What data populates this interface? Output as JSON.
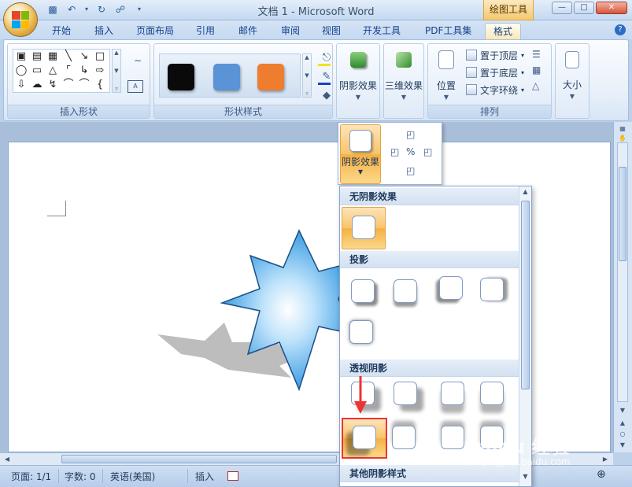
{
  "window": {
    "title": "文档 1 - Microsoft Word",
    "context_tab_label": "绘图工具"
  },
  "tabs": [
    {
      "label": "开始"
    },
    {
      "label": "插入"
    },
    {
      "label": "页面布局"
    },
    {
      "label": "引用"
    },
    {
      "label": "邮件"
    },
    {
      "label": "审阅"
    },
    {
      "label": "视图"
    },
    {
      "label": "开发工具"
    },
    {
      "label": "PDF工具集"
    },
    {
      "label": "格式",
      "active": true
    }
  ],
  "ribbon": {
    "groups": {
      "insert_shapes": "插入形状",
      "shape_styles": "形状样式",
      "arrange": "排列"
    },
    "shape_style_swatches": [
      "#0a0a0a",
      "#5a93d6",
      "#ee7d2f"
    ],
    "buttons": {
      "shadow_effects": "阴影效果",
      "3d_effects": "三维效果",
      "position": "位置",
      "bring_to_front": "置于顶层",
      "send_to_back": "置于底层",
      "text_wrapping": "文字环绕",
      "size": "大小"
    }
  },
  "shadow_panel": {
    "button_label": "阴影效果"
  },
  "dropdown": {
    "sections": [
      {
        "header": "无阴影效果"
      },
      {
        "header": "投影"
      },
      {
        "header": "透视阴影"
      },
      {
        "header": "其他阴影样式"
      }
    ]
  },
  "status": {
    "page": "页面: 1/1",
    "words": "字数: 0",
    "language": "英语(美国)",
    "mode": "插入"
  },
  "watermark": {
    "text": "Baidu 经验",
    "sub": "jingyan.baidu.com"
  },
  "colors": {
    "accent": "#f8c46b",
    "highlight": "#e33333",
    "star_blue": "#3fa3e6"
  }
}
